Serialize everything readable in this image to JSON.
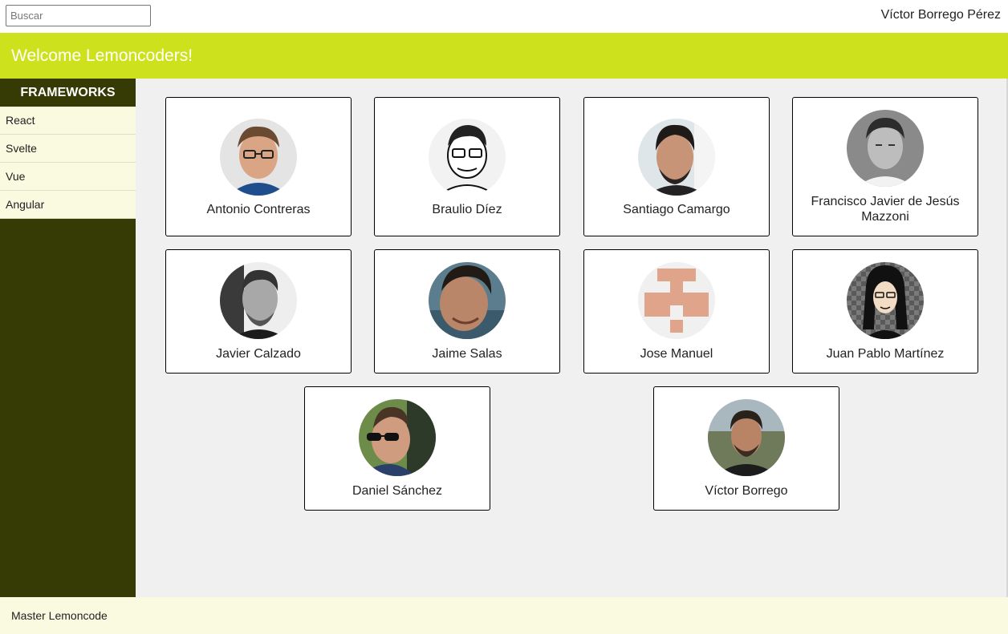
{
  "search": {
    "placeholder": "Buscar",
    "value": ""
  },
  "user": {
    "name": "Víctor Borrego Pérez"
  },
  "header": {
    "title": "Welcome Lemoncoders!"
  },
  "sidebar": {
    "title": "FRAMEWORKS",
    "items": [
      {
        "label": "React"
      },
      {
        "label": "Svelte"
      },
      {
        "label": "Vue"
      },
      {
        "label": "Angular"
      }
    ]
  },
  "members": [
    {
      "name": "Antonio Contreras",
      "avatar": "photo-avatar-icon"
    },
    {
      "name": "Braulio Díez",
      "avatar": "sketch-avatar-icon"
    },
    {
      "name": "Santiago Camargo",
      "avatar": "photo-avatar-icon"
    },
    {
      "name": "Francisco Javier de Jesús Mazzoni",
      "avatar": "photo-avatar-icon"
    },
    {
      "name": "Javier Calzado",
      "avatar": "photo-avatar-icon"
    },
    {
      "name": "Jaime Salas",
      "avatar": "photo-avatar-icon"
    },
    {
      "name": "Jose Manuel",
      "avatar": "identicon-avatar-icon"
    },
    {
      "name": "Juan Pablo Martínez",
      "avatar": "cartoon-avatar-icon"
    },
    {
      "name": "Daniel Sánchez",
      "avatar": "photo-avatar-icon"
    },
    {
      "name": "Víctor Borrego",
      "avatar": "photo-avatar-icon"
    }
  ],
  "footer": {
    "text": "Master Lemoncode"
  },
  "colors": {
    "accent": "#cde21c",
    "sidebar": "#363b06",
    "menu_bg": "#f9fadf",
    "content_bg": "#f0f0f0"
  }
}
